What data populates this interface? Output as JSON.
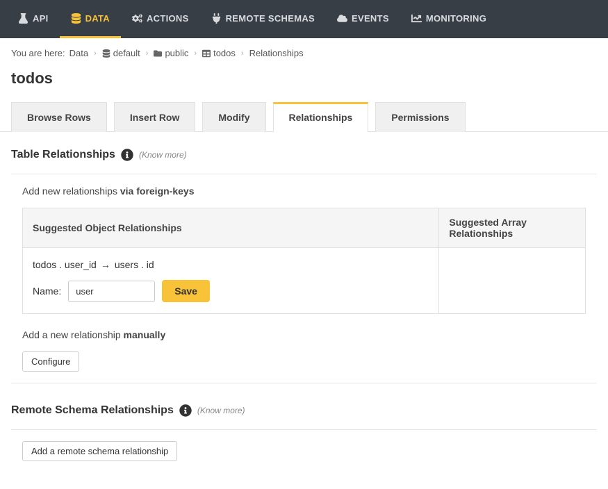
{
  "nav": {
    "api": "API",
    "data": "DATA",
    "actions": "ACTIONS",
    "remote_schemas": "REMOTE SCHEMAS",
    "events": "EVENTS",
    "monitoring": "MONITORING"
  },
  "breadcrumb": {
    "you_are_here": "You are here:",
    "data": "Data",
    "default": "default",
    "public": "public",
    "todos": "todos",
    "relationships": "Relationships"
  },
  "page_title": "todos",
  "tabs": {
    "browse": "Browse Rows",
    "insert": "Insert Row",
    "modify": "Modify",
    "relationships": "Relationships",
    "permissions": "Permissions"
  },
  "section1": {
    "title": "Table Relationships",
    "know_more": "(Know more)",
    "intro_prefix": "Add new relationships ",
    "intro_bold": "via foreign-keys",
    "col_obj": "Suggested Object Relationships",
    "col_arr": "Suggested Array Relationships",
    "fk_from": "todos . user_id",
    "fk_to": "users . id",
    "name_label": "Name:",
    "name_value": "user",
    "save": "Save",
    "manual_prefix": "Add a new relationship ",
    "manual_bold": "manually",
    "configure": "Configure"
  },
  "section2": {
    "title": "Remote Schema Relationships",
    "know_more": "(Know more)",
    "add_remote": "Add a remote schema relationship"
  }
}
